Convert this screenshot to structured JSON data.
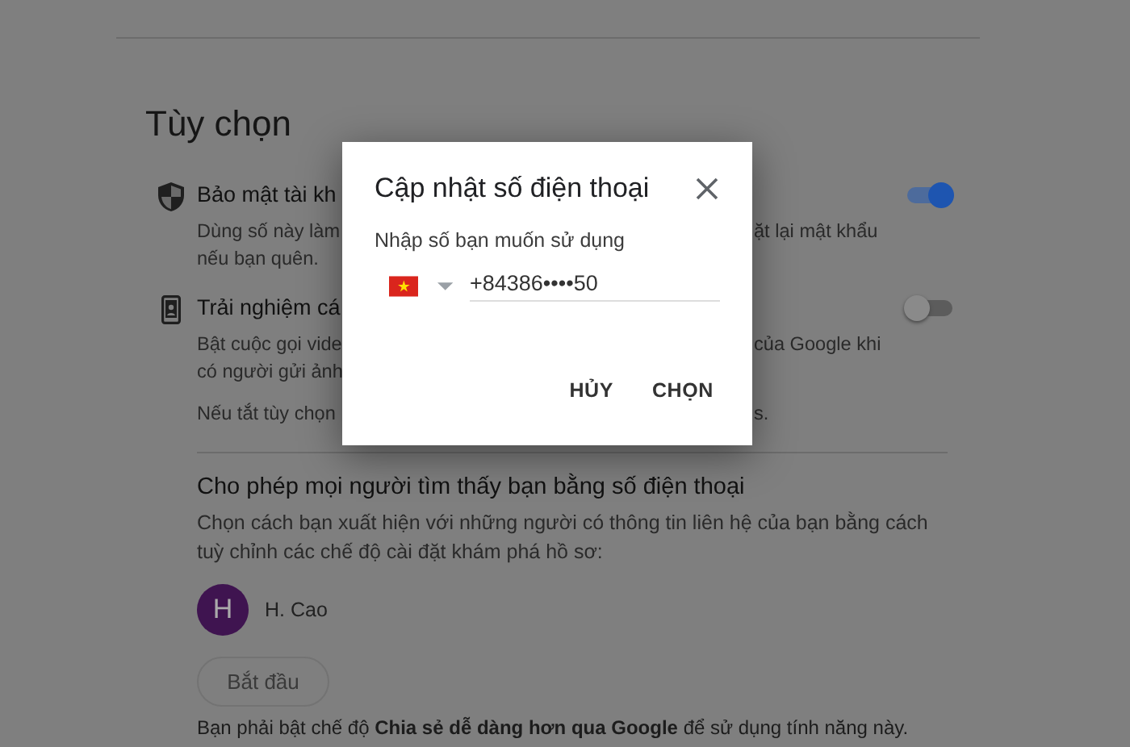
{
  "page": {
    "heading": "Tùy chọn"
  },
  "settings": [
    {
      "kind": "shield",
      "title": "Bảo mật tài kh",
      "on": true,
      "lines": [
        {
          "left": "Dùng số này làm",
          "right": "ặt lại mật khẩu"
        },
        {
          "left": "nếu bạn quên."
        }
      ]
    },
    {
      "kind": "phone",
      "title": "Trải nghiệm cá",
      "on": false,
      "lines": [
        {
          "left": "Bật cuộc gọi vide",
          "right": "của Google khi"
        },
        {
          "left": "có người gửi ảnh"
        }
      ],
      "note": {
        "left": "Nếu tắt tùy chọn",
        "right": "s."
      }
    }
  ],
  "discovery": {
    "title": "Cho phép mọi người tìm thấy bạn bằng số điện thoại",
    "description": "Chọn cách bạn xuất hiện với những người có thông tin liên hệ của bạn bằng cách tuỳ chỉnh các chế độ cài đặt khám phá hồ sơ:",
    "profile": {
      "initial": "H",
      "name": "H. Cao"
    },
    "button": {
      "label": "Bắt đầu",
      "disabled": true
    },
    "footnote": "Bạn phải bật chế độ **Chia sẻ dễ dàng hơn qua Google** để sử dụng tính năng này."
  },
  "dialog": {
    "title": "Cập nhật số điện thoại",
    "label": "Nhập số bạn muốn sử dụng",
    "phone": "+84386••••50",
    "buttons": [
      "HỦY",
      "CHỌN"
    ]
  }
}
